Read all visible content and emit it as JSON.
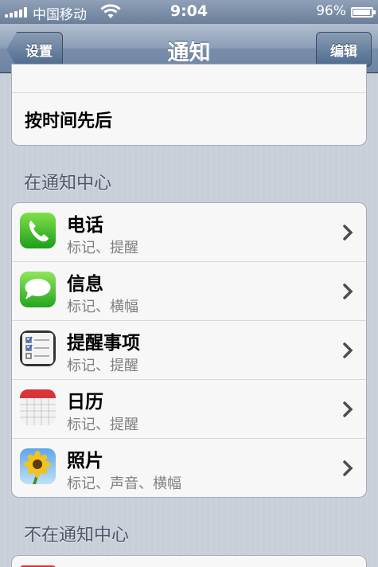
{
  "status_bar": {
    "carrier": "中国移动",
    "time": "9:04",
    "battery_percent_text": "96%",
    "battery_level": 0.96,
    "signal_bars": 5
  },
  "nav": {
    "back_label": "设置",
    "title": "通知",
    "edit_label": "编辑"
  },
  "sort": {
    "order_label": "按时间先后"
  },
  "sections": {
    "in_center": "在通知中心",
    "not_in_center": "不在通知中心"
  },
  "apps": [
    {
      "name": "电话",
      "detail": "标记、提醒",
      "icon": "phone-icon"
    },
    {
      "name": "信息",
      "detail": "标记、横幅",
      "icon": "messages-icon"
    },
    {
      "name": "提醒事项",
      "detail": "标记、提醒",
      "icon": "reminders-icon"
    },
    {
      "name": "日历",
      "detail": "标记、提醒",
      "icon": "calendar-icon"
    },
    {
      "name": "照片",
      "detail": "标记、声音、横幅",
      "icon": "photos-icon"
    }
  ],
  "colors": {
    "nav_bar": "#6d84a3",
    "section_header_text": "#4c566c",
    "detail_text": "#808080"
  }
}
